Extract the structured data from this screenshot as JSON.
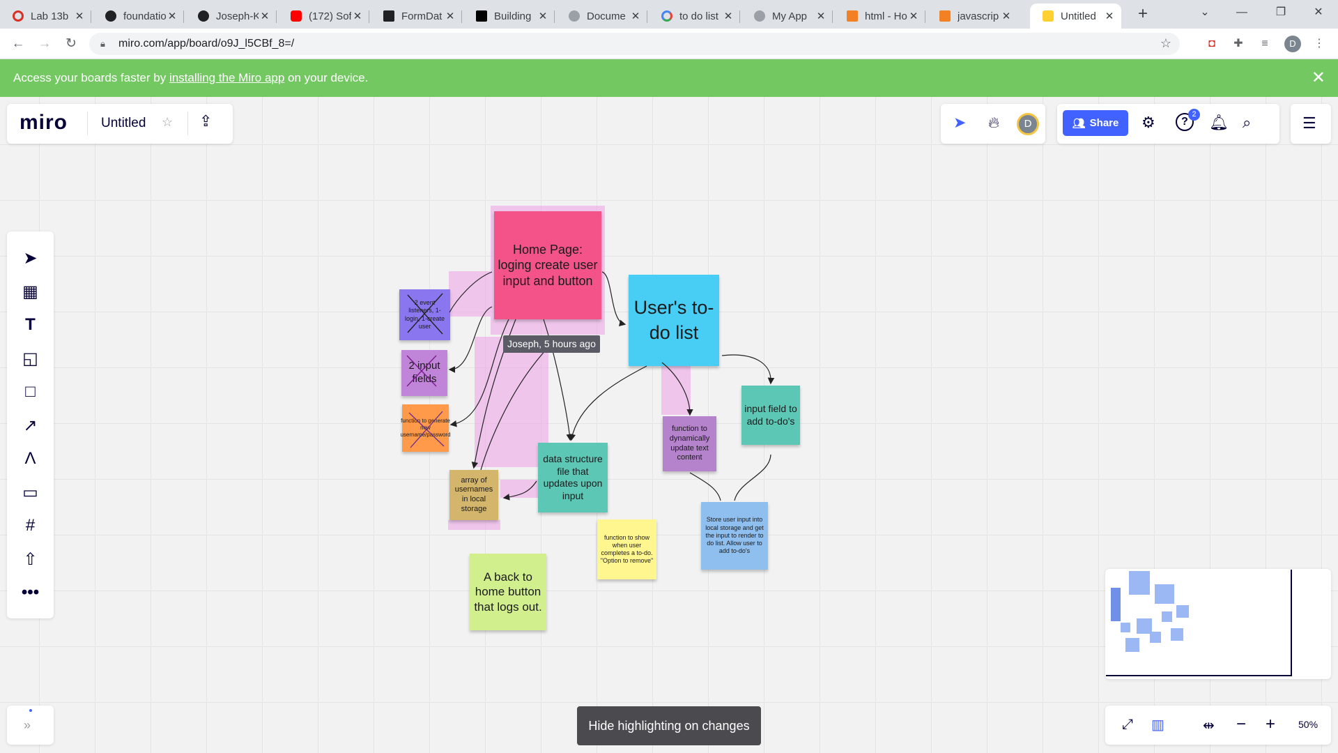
{
  "browser": {
    "tabs": [
      {
        "title": "Lab 13b",
        "icon": "red-ring-icon",
        "color": "#d93025"
      },
      {
        "title": "foundatio",
        "icon": "github-icon",
        "color": "#202124"
      },
      {
        "title": "Joseph-K",
        "icon": "github-icon",
        "color": "#202124"
      },
      {
        "title": "(172) Sof",
        "icon": "youtube-icon",
        "color": "#ff0000"
      },
      {
        "title": "FormDat",
        "icon": "formdata-icon",
        "color": "#202124"
      },
      {
        "title": "Building",
        "icon": "medium-icon",
        "color": "#000000"
      },
      {
        "title": "Docume",
        "icon": "globe-icon",
        "color": "#5f6368"
      },
      {
        "title": "to do list",
        "icon": "google-icon",
        "color": "#4285f4"
      },
      {
        "title": "My App",
        "icon": "globe-icon",
        "color": "#5f6368"
      },
      {
        "title": "html - Ho",
        "icon": "stackoverflow-icon",
        "color": "#f48024"
      },
      {
        "title": "javascrip",
        "icon": "stackoverflow-icon",
        "color": "#f48024"
      },
      {
        "title": "Untitled",
        "icon": "miro-icon",
        "color": "#ffd02f"
      }
    ],
    "url": "miro.com/app/board/o9J_l5CBf_8=/",
    "profile_initial": "D"
  },
  "banner": {
    "prefix": "Access your boards faster by ",
    "link": "installing the Miro app",
    "suffix": " on your device."
  },
  "miro": {
    "logo": "miro",
    "board_title": "Untitled",
    "share_label": "Share",
    "avatar_initial": "D",
    "notifications_badge": "2",
    "zoom": "50%",
    "hide_highlight_label": "Hide highlighting on changes",
    "tooltip": "Joseph, 5 hours ago"
  },
  "notes": {
    "home": "Home Page: loging create user input and button",
    "todo": "User's to-do list",
    "listeners": "2 event listeners, 1- login, 1-create user",
    "inputs": "2 input fields",
    "generate": "function to generate new username/password",
    "array": "array of usernames in local storage",
    "datafile": "data structure file that updates upon input",
    "dynamic": "function to dynamically update text content",
    "inputfield": "input field to add to-do's",
    "store": "Store user input into local storage and get the input to render to do list. Allow user to add to-do's",
    "complete": "function to show when user completes a to-do. \"Option to remove\"",
    "back": "A back to home button that logs out."
  },
  "colors": {
    "accent": "#4262ff",
    "banner": "#73c862",
    "highlight": "#eca0e8"
  }
}
